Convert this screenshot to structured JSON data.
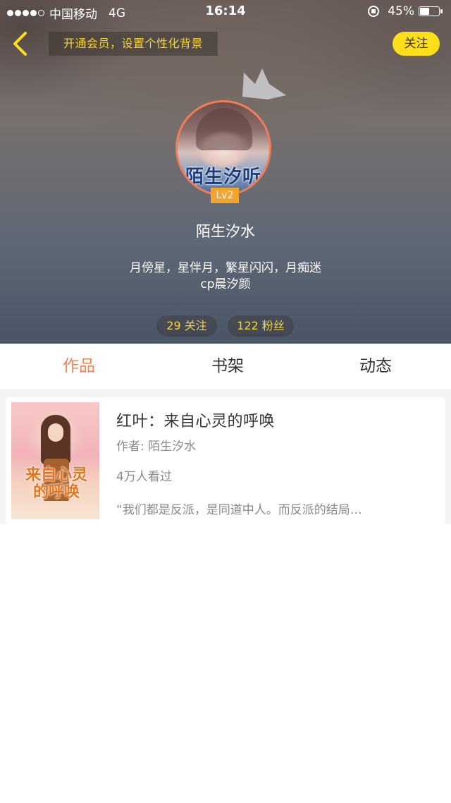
{
  "status_bar": {
    "carrier": "中国移动",
    "network": "4G",
    "time": "16:14",
    "battery": "45%",
    "battery_level": 0.45
  },
  "header": {
    "vip_banner": "开通会员，设置个性化背景",
    "follow_button": "关注",
    "level": "Lv2",
    "avatar_text": "陌生汐听",
    "username": "陌生汐水",
    "bio_line1": "月傍星，星伴月，繁星闪闪，月痴迷",
    "bio_line2": "cp晨汐颜",
    "following": "29 关注",
    "followers": "122 粉丝"
  },
  "tabs": [
    {
      "label": "作品",
      "active": true
    },
    {
      "label": "书架",
      "active": false
    },
    {
      "label": "动态",
      "active": false
    }
  ],
  "works": [
    {
      "title": "红叶：来自心灵的呼唤",
      "author": "作者: 陌生汐水",
      "views": "4万人看过",
      "excerpt": "“我们都是反派，是同道中人。而反派的结局…",
      "cover_title": "来自心灵的呼唤"
    }
  ],
  "colors": {
    "accent": "#f08553",
    "follow_yellow": "#ffdf1c",
    "gold_text": "#f6d33c",
    "level_badge": "#f3a42d"
  }
}
